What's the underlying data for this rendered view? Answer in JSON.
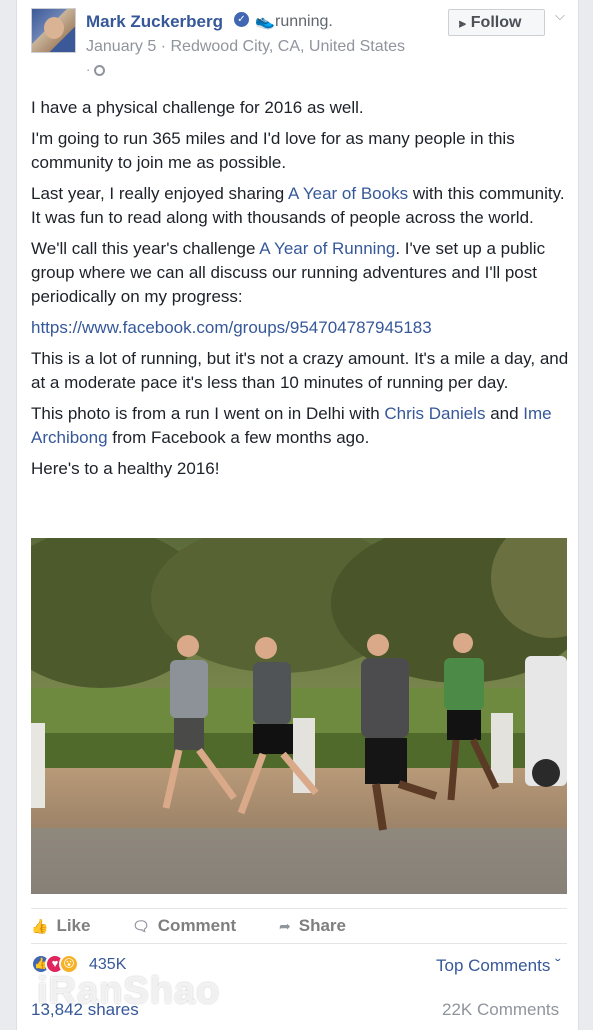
{
  "post": {
    "author": "Mark Zuckerberg",
    "activity": "running.",
    "date_location": "January 5 · Redwood City, CA, United States",
    "privacy_dot": "·",
    "follow_label": "Follow",
    "paragraphs": {
      "p1": "I have a physical challenge for 2016 as well.",
      "p2": "I'm going to run 365 miles and I'd love for as many people in this community to join me as possible.",
      "p3_before": "Last year, I really enjoyed sharing ",
      "p3_link": "A Year of Books",
      "p3_after": " with this community. It was fun to read along with thousands of people across the world.",
      "p4_before": "We'll call this year's challenge ",
      "p4_link": "A Year of Running",
      "p4_after": ". I've set up a public group where we can all discuss our running adventures and I'll post periodically on my progress:",
      "p5_link": "https://www.facebook.com/groups/954704787945183",
      "p6": "This is a lot of running, but it's not a crazy amount. It's a mile a day, and at a moderate pace it's less than 10 minutes of running per day.",
      "p7_before": "This photo is from a run I went on in Delhi with ",
      "p7_link1": "Chris Daniels",
      "p7_mid": " and ",
      "p7_link2": "Ime Archibong",
      "p7_after": " from Facebook a few months ago.",
      "p8": "Here's to a healthy 2016!"
    }
  },
  "actions": {
    "like": "Like",
    "comment": "Comment",
    "share": "Share"
  },
  "stats": {
    "reactions_count": "435K",
    "top_comments": "Top Comments",
    "shares": "13,842 shares",
    "comments": "22K Comments"
  },
  "watermark": "iRanShao",
  "colors": {
    "link": "#365899",
    "muted": "#90949c",
    "text": "#1d2129"
  }
}
